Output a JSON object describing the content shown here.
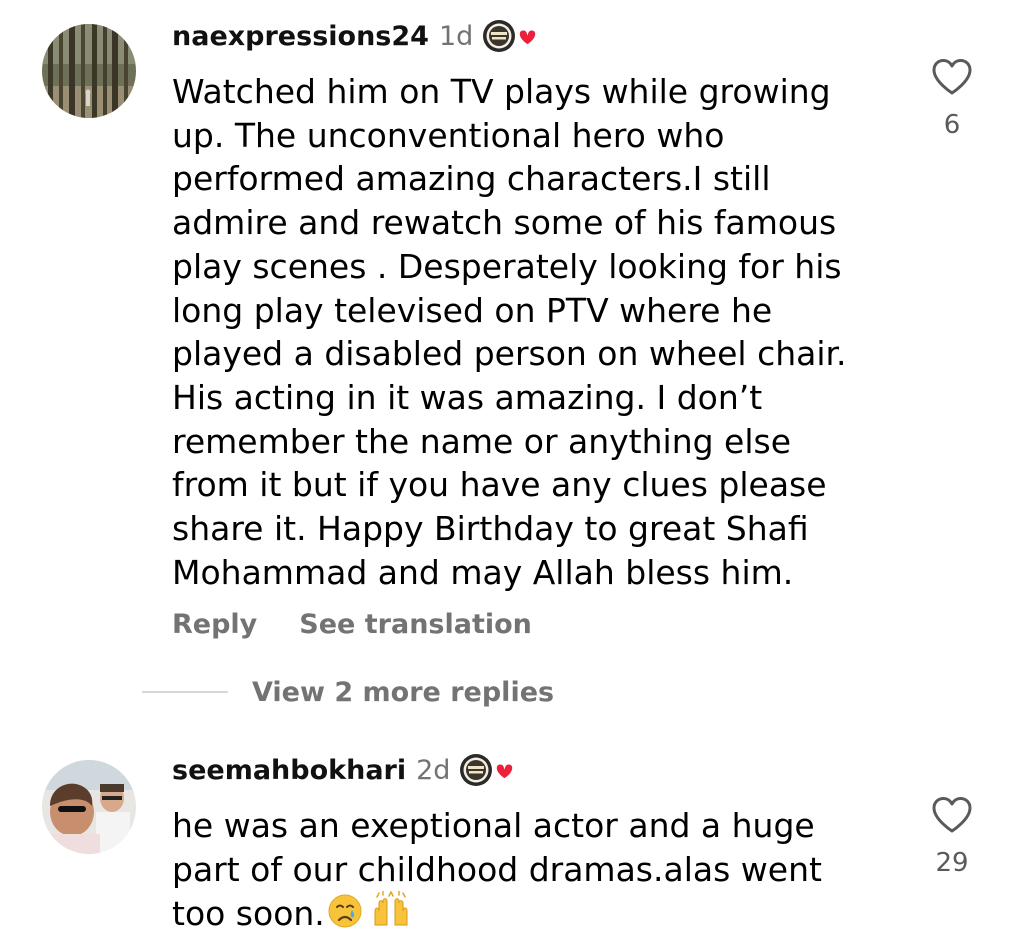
{
  "colors": {
    "username": "#111111",
    "muted": "#737373",
    "heart_badge": "#ee1f3b",
    "divider": "#d8d8d8"
  },
  "comments": [
    {
      "username": "naexpressions24",
      "time": "1d",
      "lines": [
        "Watched him on TV plays while growing",
        "up. The unconventional hero who",
        "performed amazing characters.I still",
        "admire and rewatch some of his famous",
        "play scenes . Desperately looking for his",
        "long play televised on PTV where he",
        "played a disabled person on wheel chair.",
        "His acting in it was amazing. I don’t",
        "remember the name or anything else",
        "from it but if you have any clues please",
        "share it. Happy Birthday to great Shafi",
        "Mohammad and may Allah bless him."
      ],
      "like_count": "6",
      "like_icon": "heart-outline-icon",
      "author_badge_icon": "creator-heart-badge-icon",
      "actions": {
        "reply": "Reply",
        "translate": "See translation"
      },
      "view_replies": "View 2 more replies"
    },
    {
      "username": "seemahbokhari",
      "time": "2d",
      "lines": [
        "he was an exeptional actor and a huge",
        "part of our childhood dramas.alas went",
        "too soon."
      ],
      "emojis": [
        "crying-face-emoji",
        "raising-hands-emoji"
      ],
      "like_count": "29",
      "like_icon": "heart-outline-icon",
      "author_badge_icon": "creator-heart-badge-icon"
    }
  ]
}
